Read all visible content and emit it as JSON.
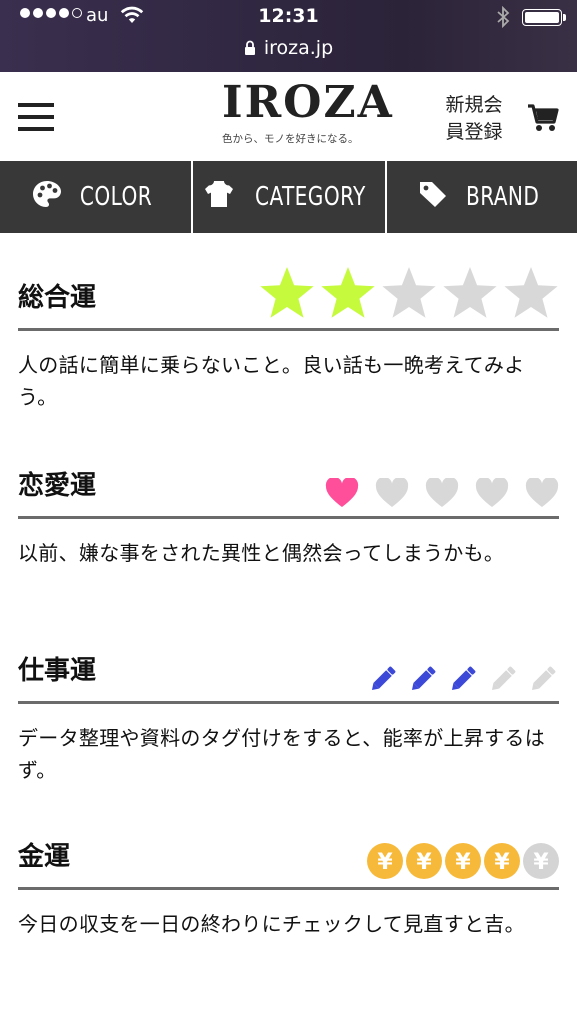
{
  "status_bar": {
    "carrier": "au",
    "time": "12:31",
    "url": "iroza.jp",
    "signal_total": 5,
    "signal_filled": 4
  },
  "header": {
    "logo": "IROZA",
    "tagline": "色から、モノを好きになる。",
    "register_line1": "新規会",
    "register_line2": "員登録"
  },
  "nav": [
    {
      "label": "COLOR",
      "icon": "palette-icon"
    },
    {
      "label": "CATEGORY",
      "icon": "tshirt-icon"
    },
    {
      "label": "BRAND",
      "icon": "tag-icon"
    }
  ],
  "fortunes": [
    {
      "title": "総合運",
      "icon": "star-icon",
      "score": 2,
      "max": 5,
      "active_color": "#c5fb3c",
      "inactive_color": "#d8d8d8",
      "text": "人の話に簡単に乗らないこと。良い話も一晩考えてみよう。"
    },
    {
      "title": "恋愛運",
      "icon": "heart-icon",
      "score": 1,
      "max": 5,
      "active_color": "#ff4f9a",
      "inactive_color": "#d8d8d8",
      "text": "以前、嫌な事をされた異性と偶然会ってしまうかも。"
    },
    {
      "title": "仕事運",
      "icon": "pencil-icon",
      "score": 3,
      "max": 5,
      "active_color": "#3c49d8",
      "inactive_color": "#d8d8d8",
      "text": "データ整理や資料のタグ付けをすると、能率が上昇するはず。"
    },
    {
      "title": "金運",
      "icon": "yen-coin-icon",
      "score": 4,
      "max": 5,
      "active_color": "#f7b93a",
      "inactive_color": "#d4d4d4",
      "text": "今日の収支を一日の終わりにチェックして見直すと吉。"
    }
  ]
}
